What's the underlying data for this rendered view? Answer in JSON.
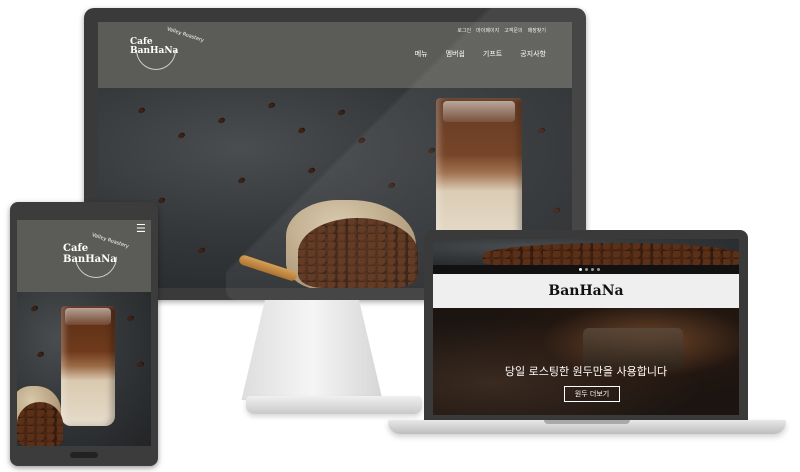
{
  "desktop": {
    "logo": {
      "line1": "Cafe",
      "line2": "BanHaNa",
      "subtitle": "Valley Roastery"
    },
    "util_nav": [
      "로그인",
      "마이페이지",
      "고객문의",
      "매장찾기"
    ],
    "main_nav": [
      "메뉴",
      "멤버쉽",
      "기프트",
      "공지사항"
    ]
  },
  "tablet": {
    "logo": {
      "line1": "Cafe",
      "line2": "BanHaNa",
      "subtitle": "Valley Roastery"
    },
    "menu_icon": "hamburger-icon"
  },
  "laptop": {
    "brand": "BanHaNa",
    "tagline": "당일 로스팅한 원두만을 사용합니다",
    "button": "원두 더보기",
    "slider_dots": 4,
    "active_dot": 1
  }
}
